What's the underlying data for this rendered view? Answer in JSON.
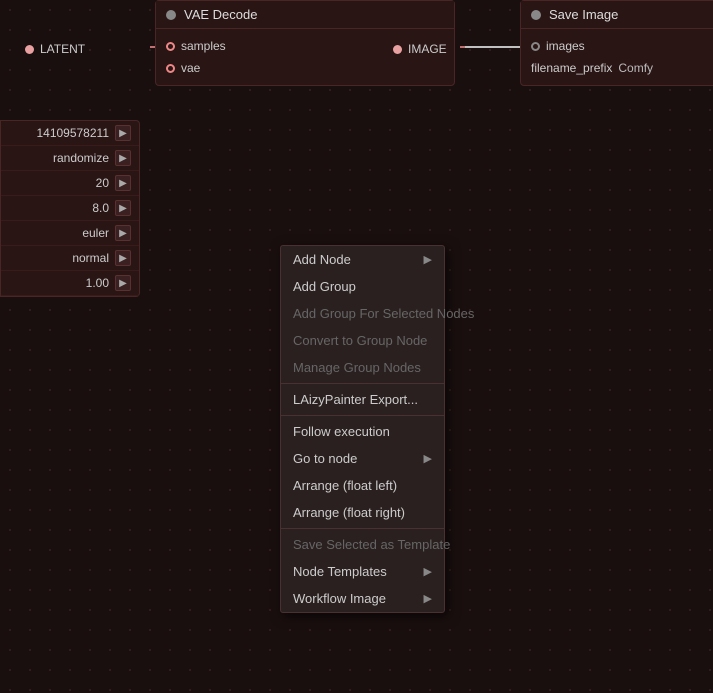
{
  "canvas": {
    "bg_color": "#1a0f0f"
  },
  "nodes": {
    "vae_decode": {
      "title": "VAE Decode",
      "ports_in": [
        "samples",
        "vae"
      ],
      "port_in_colors": [
        "pink",
        "pink"
      ]
    },
    "save_image": {
      "title": "Save Image",
      "ports_in": [
        "images"
      ],
      "fields": [
        {
          "label": "filename_prefix",
          "value": "Comfy"
        }
      ]
    },
    "sampler": {
      "values": [
        "14109578211",
        "randomize",
        "20",
        "8.0",
        "euler",
        "normal",
        "1.00"
      ]
    }
  },
  "labels": {
    "latent": "LATENT",
    "image": "IMAGE"
  },
  "context_menu": {
    "items": [
      {
        "label": "Add Node",
        "has_arrow": true,
        "disabled": false
      },
      {
        "label": "Add Group",
        "has_arrow": false,
        "disabled": false
      },
      {
        "label": "Add Group For Selected Nodes",
        "has_arrow": false,
        "disabled": true
      },
      {
        "label": "Convert to Group Node",
        "has_arrow": false,
        "disabled": true
      },
      {
        "label": "Manage Group Nodes",
        "has_arrow": false,
        "disabled": true
      },
      {
        "separator": true
      },
      {
        "label": "LAizyPainter Export...",
        "has_arrow": false,
        "disabled": false
      },
      {
        "separator": true
      },
      {
        "label": "Follow execution",
        "has_arrow": false,
        "disabled": false
      },
      {
        "label": "Go to node",
        "has_arrow": true,
        "disabled": false
      },
      {
        "label": "Arrange (float left)",
        "has_arrow": false,
        "disabled": false
      },
      {
        "label": "Arrange (float right)",
        "has_arrow": false,
        "disabled": false
      },
      {
        "separator": true
      },
      {
        "label": "Save Selected as Template",
        "has_arrow": false,
        "disabled": true
      },
      {
        "label": "Node Templates",
        "has_arrow": true,
        "disabled": false
      },
      {
        "label": "Workflow Image",
        "has_arrow": true,
        "disabled": false
      }
    ]
  }
}
